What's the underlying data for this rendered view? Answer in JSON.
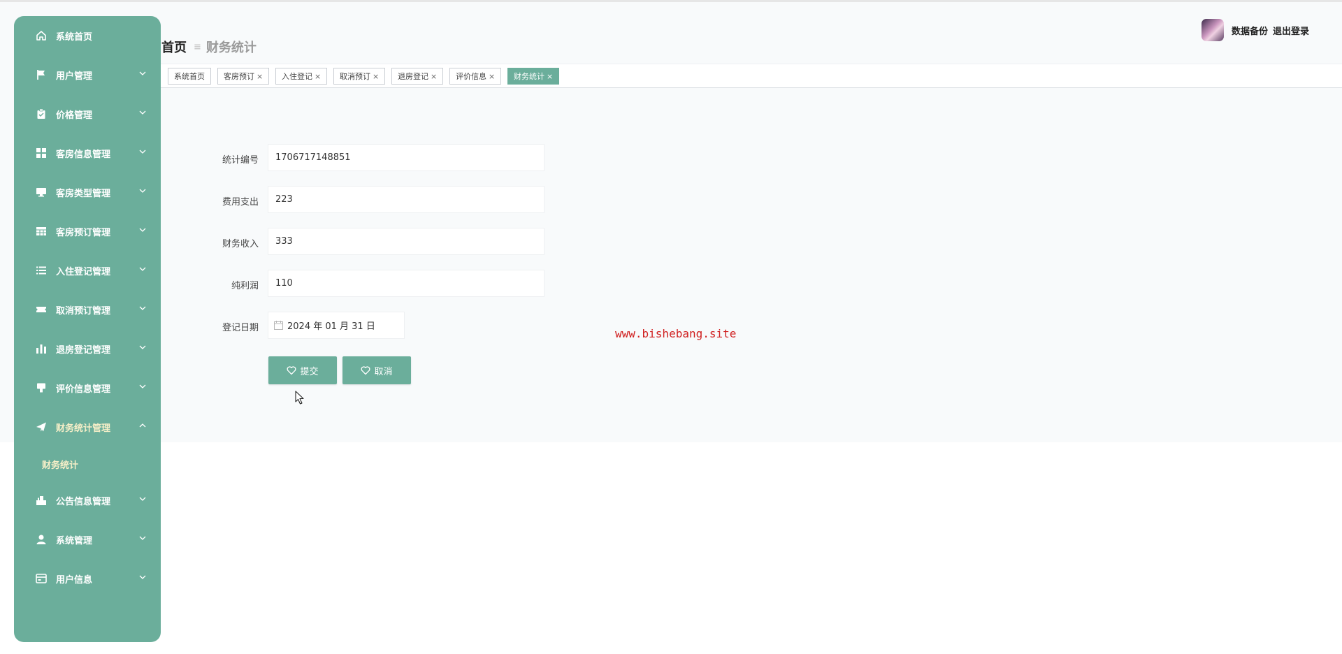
{
  "sidebar": {
    "items": [
      {
        "label": "系统首页",
        "icon": "home-icon",
        "chevron": false
      },
      {
        "label": "用户管理",
        "icon": "flag-icon",
        "chevron": true
      },
      {
        "label": "价格管理",
        "icon": "clipboard-icon",
        "chevron": true
      },
      {
        "label": "客房信息管理",
        "icon": "grid-icon",
        "chevron": true
      },
      {
        "label": "客房类型管理",
        "icon": "monitor-icon",
        "chevron": true
      },
      {
        "label": "客房预订管理",
        "icon": "table-icon",
        "chevron": true
      },
      {
        "label": "入住登记管理",
        "icon": "list-icon",
        "chevron": true
      },
      {
        "label": "取消预订管理",
        "icon": "ticket-icon",
        "chevron": true
      },
      {
        "label": "退房登记管理",
        "icon": "bar-chart-icon",
        "chevron": true
      },
      {
        "label": "评价信息管理",
        "icon": "comment-icon",
        "chevron": true
      },
      {
        "label": "财务统计管理",
        "icon": "paper-plane-icon",
        "chevron": true,
        "expanded": true
      },
      {
        "label": "公告信息管理",
        "icon": "megaphone-icon",
        "chevron": true
      },
      {
        "label": "系统管理",
        "icon": "user-icon",
        "chevron": true
      },
      {
        "label": "用户信息",
        "icon": "id-card-icon",
        "chevron": true
      }
    ],
    "submenu": {
      "label": "财务统计"
    }
  },
  "breadcrumb": {
    "home": "首页",
    "separator": "≡",
    "current": "财务统计"
  },
  "header": {
    "backup": "数据备份",
    "logout": "退出登录"
  },
  "tabs": [
    {
      "label": "系统首页",
      "closable": false
    },
    {
      "label": "客房预订",
      "closable": true
    },
    {
      "label": "入住登记",
      "closable": true
    },
    {
      "label": "取消预订",
      "closable": true
    },
    {
      "label": "退房登记",
      "closable": true
    },
    {
      "label": "评价信息",
      "closable": true
    },
    {
      "label": "财务统计",
      "closable": true,
      "active": true
    }
  ],
  "tab_close_glyph": "×",
  "form": {
    "fields": [
      {
        "label": "统计编号",
        "value": "1706717148851"
      },
      {
        "label": "费用支出",
        "value": "223"
      },
      {
        "label": "财务收入",
        "value": "333"
      },
      {
        "label": "纯利润",
        "value": "110"
      }
    ],
    "date": {
      "label": "登记日期",
      "value": "2024 年 01 月 31 日"
    },
    "submit": "提交",
    "cancel": "取消"
  },
  "watermark": "www.bishebang.site",
  "colors": {
    "accent": "#6bae9b",
    "submenu_active": "#f6efc8",
    "watermark": "#d02020"
  }
}
